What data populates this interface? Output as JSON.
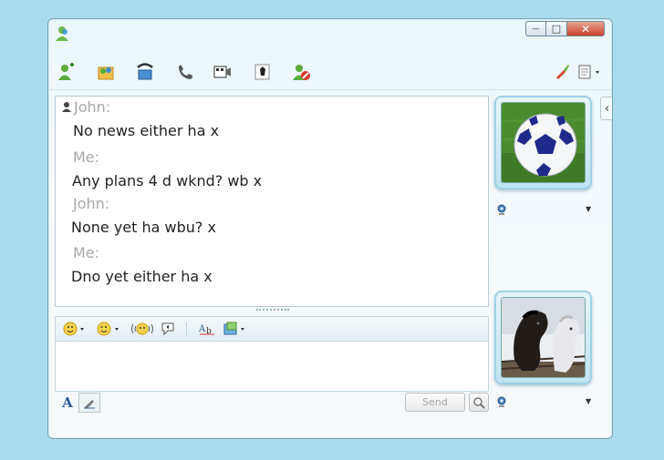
{
  "window": {
    "close_symbol": "✕",
    "minimize_symbol": "—",
    "maximize_symbol": "□"
  },
  "toolbar": {
    "icons": [
      "invite-contact-icon",
      "share-files-icon",
      "call-computer-icon",
      "call-phone-icon",
      "video-icon",
      "games-icon",
      "block-icon",
      "paint-icon",
      "show-menu-icon"
    ]
  },
  "conversation": {
    "messages": [
      {
        "sender": "John:",
        "text": "No news either ha x"
      },
      {
        "sender": "Me:",
        "text": "Any plans 4 d wknd? wb x"
      },
      {
        "sender": "John:",
        "text": "None yet ha wbu? x"
      },
      {
        "sender": "Me:",
        "text": "Dno yet either ha x"
      }
    ]
  },
  "compose": {
    "value": "",
    "send_label": "Send",
    "font_label": "A"
  },
  "formatting": {
    "icons": [
      "emoticon-icon",
      "wink-icon",
      "nudge-icon",
      "voice-clip-icon",
      "spell-check-icon",
      "background-icon"
    ]
  },
  "sidebar": {
    "collapse_symbol": "‹",
    "contact_picture": "soccer-ball",
    "my_picture": "horses"
  },
  "colors": {
    "background": "#a8dcec",
    "sender_name": "#a7a7a7",
    "message_text": "#222222",
    "close_button": "#c9452e"
  }
}
